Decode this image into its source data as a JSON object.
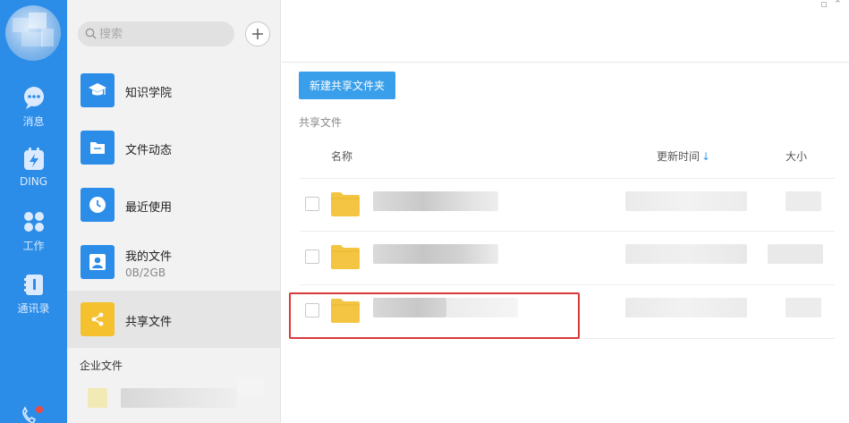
{
  "rail": {
    "items": [
      {
        "label": "消息",
        "icon": "chat-icon"
      },
      {
        "label": "DING",
        "icon": "ding-icon"
      },
      {
        "label": "工作",
        "icon": "grid-icon"
      },
      {
        "label": "通讯录",
        "icon": "contacts-icon"
      }
    ]
  },
  "search": {
    "placeholder": "搜索"
  },
  "nav": {
    "items": [
      {
        "title": "知识学院",
        "icon": "graduation-cap-icon",
        "color": "#2b8de8"
      },
      {
        "title": "文件动态",
        "icon": "folder-icon",
        "color": "#2b8de8"
      },
      {
        "title": "最近使用",
        "icon": "clock-icon",
        "color": "#2b8de8"
      },
      {
        "title": "我的文件",
        "subtitle": "0B/2GB",
        "icon": "person-icon",
        "color": "#2b8de8"
      },
      {
        "title": "共享文件",
        "icon": "share-icon",
        "color": "#f6c12e"
      }
    ],
    "enterprise_heading": "企业文件"
  },
  "main": {
    "new_folder_button": "新建共享文件夹",
    "section_title": "共享文件",
    "columns": {
      "name": "名称",
      "updated": "更新时间",
      "sort_arrow": "↓",
      "size": "大小"
    }
  },
  "colors": {
    "accent": "#2b8de8",
    "button": "#3a9fea",
    "folder": "#f4c542",
    "highlight": "#d83a3a"
  }
}
